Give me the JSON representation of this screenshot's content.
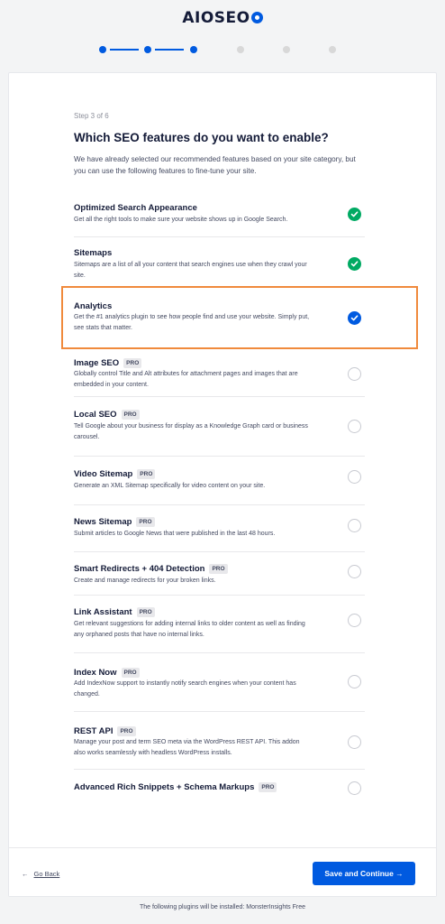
{
  "logo": {
    "text": "AIOSEO"
  },
  "stepper": {
    "total": 6,
    "current": 3
  },
  "step_label": "Step 3 of 6",
  "heading": "Which SEO features do you want to enable?",
  "intro": "We have already selected our recommended features based on your site category, but you can use the following features to fine-tune your site.",
  "features": [
    {
      "title": "Optimized Search Appearance",
      "pro": false,
      "desc": "Get all the right tools to make sure your website shows up in Google Search.",
      "state": "checked-green"
    },
    {
      "title": "Sitemaps",
      "pro": false,
      "desc": "Sitemaps are a list of all your content that search engines use when they crawl your site.",
      "state": "checked-green"
    },
    {
      "title": "Analytics",
      "pro": false,
      "desc": "Get the #1 analytics plugin to see how people find and use your website. Simply put, see stats that matter.",
      "state": "checked-blue"
    },
    {
      "title": "Image SEO",
      "pro": true,
      "desc": "Globally control Title and Alt attributes for attachment pages and images that are embedded in your content.",
      "state": "unchecked"
    },
    {
      "title": "Local SEO",
      "pro": true,
      "desc": "Tell Google about your business for display as a Knowledge Graph card or business carousel.",
      "state": "unchecked"
    },
    {
      "title": "Video Sitemap",
      "pro": true,
      "desc": "Generate an XML Sitemap specifically for video content on your site.",
      "state": "unchecked"
    },
    {
      "title": "News Sitemap",
      "pro": true,
      "desc": "Submit articles to Google News that were published in the last 48 hours.",
      "state": "unchecked"
    },
    {
      "title": "Smart Redirects + 404 Detection",
      "pro": true,
      "desc": "Create and manage redirects for your broken links.",
      "state": "unchecked"
    },
    {
      "title": "Link Assistant",
      "pro": true,
      "desc": "Get relevant suggestions for adding internal links to older content as well as finding any orphaned posts that have no internal links.",
      "state": "unchecked"
    },
    {
      "title": "Index Now",
      "pro": true,
      "desc": "Add IndexNow support to instantly notify search engines when your content has changed.",
      "state": "unchecked"
    },
    {
      "title": "REST API",
      "pro": true,
      "desc": "Manage your post and term SEO meta via the WordPress REST API. This addon also works seamlessly with headless WordPress installs.",
      "state": "unchecked"
    },
    {
      "title": "Advanced Rich Snippets + Schema Markups",
      "pro": true,
      "desc": "",
      "state": "unchecked"
    }
  ],
  "pro_badge": "PRO",
  "footer": {
    "back_arrow": "←",
    "back_label": "Go Back",
    "save_label": "Save and Continue →"
  },
  "install_note": "The following plugins will be installed: MonsterInsights Free",
  "colors": {
    "brand": "#005ae0",
    "check_green": "#00aa63",
    "highlight": "#f08a3c"
  }
}
